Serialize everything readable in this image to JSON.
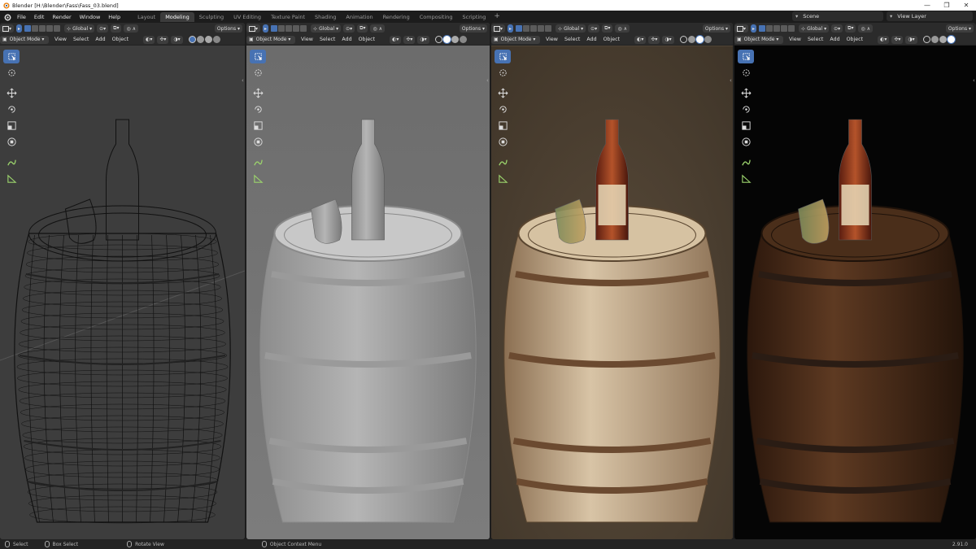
{
  "window": {
    "title": "Blender [H:\\Blender\\Fass\\Fass_03.blend]",
    "controls": [
      "—",
      "❐",
      "✕"
    ]
  },
  "menu": [
    "File",
    "Edit",
    "Render",
    "Window",
    "Help"
  ],
  "workspaces": [
    {
      "label": "Layout",
      "active": false
    },
    {
      "label": "Modeling",
      "active": true
    },
    {
      "label": "Sculpting",
      "active": false
    },
    {
      "label": "UV Editing",
      "active": false
    },
    {
      "label": "Texture Paint",
      "active": false
    },
    {
      "label": "Shading",
      "active": false
    },
    {
      "label": "Animation",
      "active": false
    },
    {
      "label": "Rendering",
      "active": false
    },
    {
      "label": "Compositing",
      "active": false
    },
    {
      "label": "Scripting",
      "active": false
    }
  ],
  "add_workspace": "+",
  "scene": {
    "label": "Scene"
  },
  "view_layer": {
    "label": "View Layer"
  },
  "viewport_header": {
    "orientation": "Global",
    "options": "Options",
    "mode": "Object Mode",
    "view": "View",
    "select": "Select",
    "add": "Add",
    "object": "Object"
  },
  "viewports": [
    {
      "name": "wireframe",
      "shading": "Wireframe",
      "bg": "#3d3d3d"
    },
    {
      "name": "solid",
      "shading": "Solid",
      "bg": "#6e6e6e"
    },
    {
      "name": "material-preview",
      "shading": "Material Preview",
      "bg": "#4f4436"
    },
    {
      "name": "rendered",
      "shading": "Rendered",
      "bg": "#050505"
    }
  ],
  "toolbar_icons": [
    "select-box-icon",
    "cursor-icon",
    "move-icon",
    "rotate-icon",
    "scale-icon",
    "transform-icon",
    "annotate-icon",
    "measure-icon"
  ],
  "status": {
    "select": "Select",
    "box_select": "Box Select",
    "rotate_view": "Rotate View",
    "context_menu": "Object Context Menu",
    "version": "2.91.0"
  },
  "colors": {
    "accent": "#4772b3",
    "header": "#2b2b2b",
    "topbar": "#1c1c1c"
  }
}
